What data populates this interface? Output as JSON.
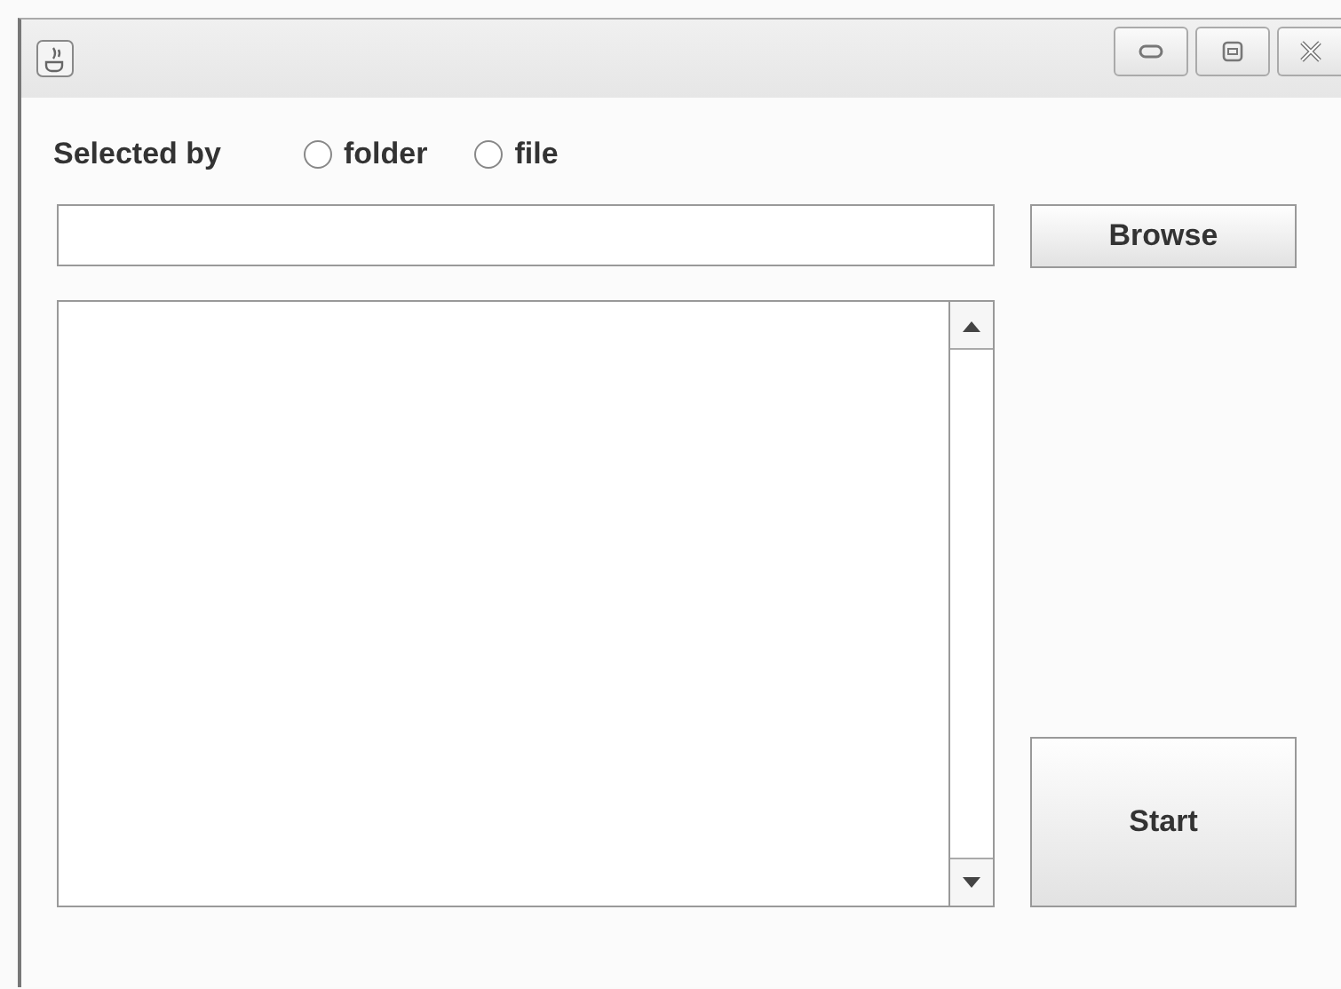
{
  "selection": {
    "label": "Selected by",
    "options": [
      {
        "label": "folder",
        "selected": false
      },
      {
        "label": "file",
        "selected": false
      }
    ]
  },
  "buttons": {
    "browse": "Browse",
    "start": "Start"
  }
}
